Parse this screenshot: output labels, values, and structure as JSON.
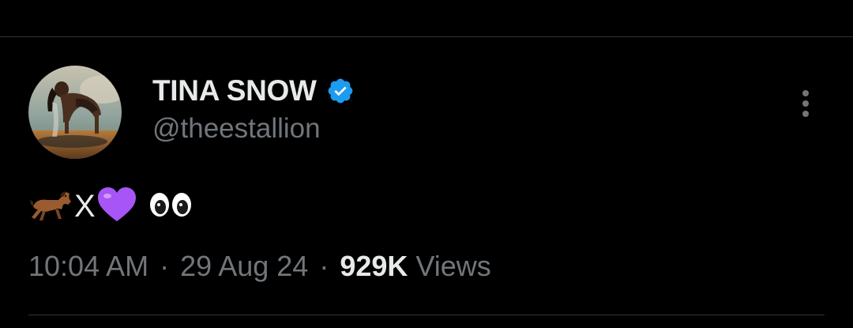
{
  "author": {
    "display_name": "TINA SNOW",
    "handle": "@theestallion",
    "verified": true,
    "verified_badge_color": "#1d9bf0",
    "avatar_icon": "profile-photo"
  },
  "tweet": {
    "emoji_sequence": [
      "horse-emoji",
      "purple-heart-emoji",
      "eyes-emoji"
    ],
    "x_letter": "X"
  },
  "meta": {
    "time": "10:04 AM",
    "separator": "·",
    "date": "29 Aug 24",
    "views_count": "929K",
    "views_label": "Views"
  },
  "menu": {
    "icon": "more-options-icon"
  },
  "colors": {
    "background": "#000000",
    "primary_text": "#e7e9ea",
    "secondary_text": "#71767b",
    "divider": "#2f3336",
    "heart": "#a855f7"
  }
}
